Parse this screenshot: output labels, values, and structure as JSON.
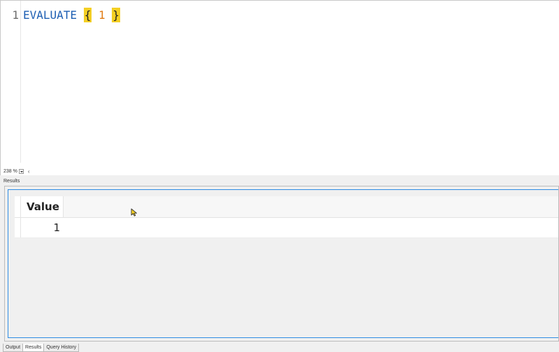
{
  "editor": {
    "line_number": "1",
    "code": {
      "keyword": "EVALUATE",
      "open_brace": "{",
      "number": "1",
      "close_brace": "}"
    },
    "zoom": "238 %"
  },
  "results": {
    "panel_label": "Results",
    "columns": [
      "Value"
    ],
    "rows": [
      [
        "1"
      ]
    ]
  },
  "bottom_tabs": [
    {
      "label": "Output",
      "active": false
    },
    {
      "label": "Results",
      "active": true
    },
    {
      "label": "Query History",
      "active": false
    }
  ],
  "colors": {
    "keyword": "#1e5fb3",
    "number": "#e07a12",
    "brace_highlight": "#f4cf24",
    "selection_border": "#2f8de4"
  }
}
